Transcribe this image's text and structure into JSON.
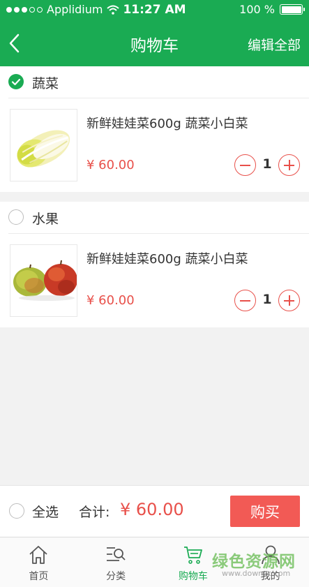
{
  "status_bar": {
    "carrier": "Applidium",
    "time": "11:27 AM",
    "battery": "100 %"
  },
  "nav": {
    "title": "购物车",
    "edit_all": "编辑全部"
  },
  "groups": [
    {
      "name": "蔬菜",
      "checked": true,
      "item": {
        "name": "新鲜娃娃菜600g 蔬菜小白菜",
        "price": "¥ 60.00",
        "quantity": "1",
        "image": "napa-cabbage"
      }
    },
    {
      "name": "水果",
      "checked": false,
      "item": {
        "name": "新鲜娃娃菜600g 蔬菜小白菜",
        "price": "¥ 60.00",
        "quantity": "1",
        "image": "apples"
      }
    }
  ],
  "checkout": {
    "select_all": "全选",
    "total_label": "合计:",
    "total_value": "¥ 60.00",
    "buy_label": "购买"
  },
  "tabs": [
    {
      "label": "首页",
      "icon": "home-icon",
      "active": false
    },
    {
      "label": "分类",
      "icon": "category-search-icon",
      "active": false
    },
    {
      "label": "购物车",
      "icon": "cart-icon",
      "active": true
    },
    {
      "label": "我的",
      "icon": "user-icon",
      "active": false
    }
  ],
  "watermark": {
    "text": "绿色资源网",
    "sub": "www.downcc.com"
  },
  "colors": {
    "brand_green": "#1aab53",
    "price_red": "#e8504a",
    "buy_button": "#f25a55"
  }
}
